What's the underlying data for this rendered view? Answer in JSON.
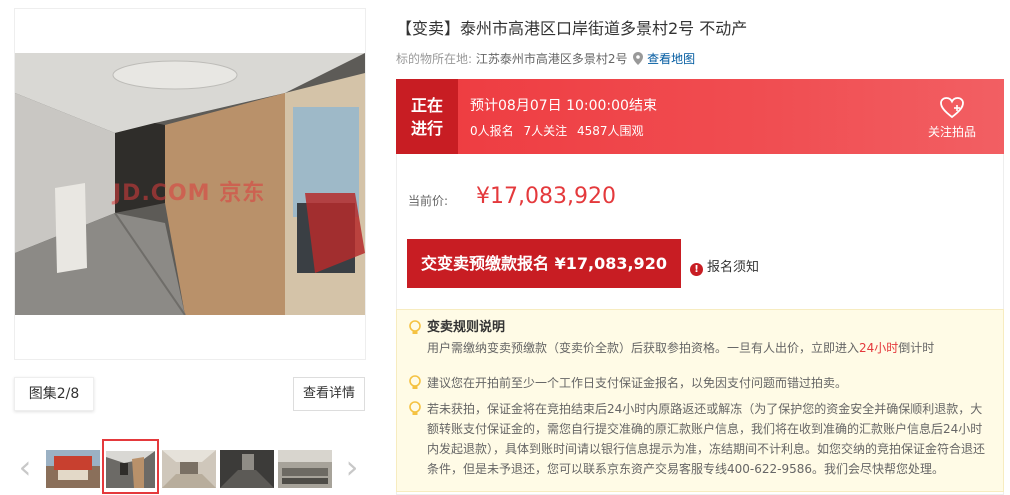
{
  "gallery": {
    "watermark": "JD.COM 京东",
    "album_label": "图集2/8",
    "detail_button": "查看详情"
  },
  "listing": {
    "title": "【变卖】泰州市高港区口岸街道多景村2号 不动产",
    "location_key": "标的物所在地:",
    "location_value": "江苏泰州市高港区多景村2号",
    "map_link": "查看地图"
  },
  "auction": {
    "status_line1": "正在",
    "status_line2": "进行",
    "end_time": "预计08月07日 10:00:00结束",
    "signups": "0人报名",
    "followers": "7人关注",
    "viewers": "4587人围观",
    "follow_label": "关注拍品",
    "price_label": "当前价:",
    "current_price": "¥17,083,920",
    "pay_button": "交变卖预缴款报名 ¥17,083,920",
    "notice_label": "报名须知"
  },
  "rules": {
    "title": "变卖规则说明",
    "line1_a": "用户需缴纳变卖预缴款（变卖价全款）后获取参拍资格。一旦有人出价，立即进入",
    "line1_hl": "24小时",
    "line1_b": "倒计时",
    "line2": "建议您在开拍前至少一个工作日支付保证金报名，以免因支付问题而错过拍卖。",
    "line3": "若未获拍，保证金将在竞拍结束后24小时内原路返还或解冻（为了保护您的资金安全并确保顺利退款，大额转账支付保证金的，需您自行提交准确的原汇款账户信息，我们将在收到准确的汇款账户信息后24小时内发起退款），具体到账时间请以银行信息提示为准，冻结期间不计利息。如您交纳的竞拍保证金符合退还条件，但是未予退还，您可以联系京东资产交易客服专线400-622-9586。我们会尽快帮您处理。"
  },
  "colors": {
    "brand_red": "#e4393c",
    "dark_red": "#c81d23",
    "notice_bg": "#fffbe6"
  }
}
